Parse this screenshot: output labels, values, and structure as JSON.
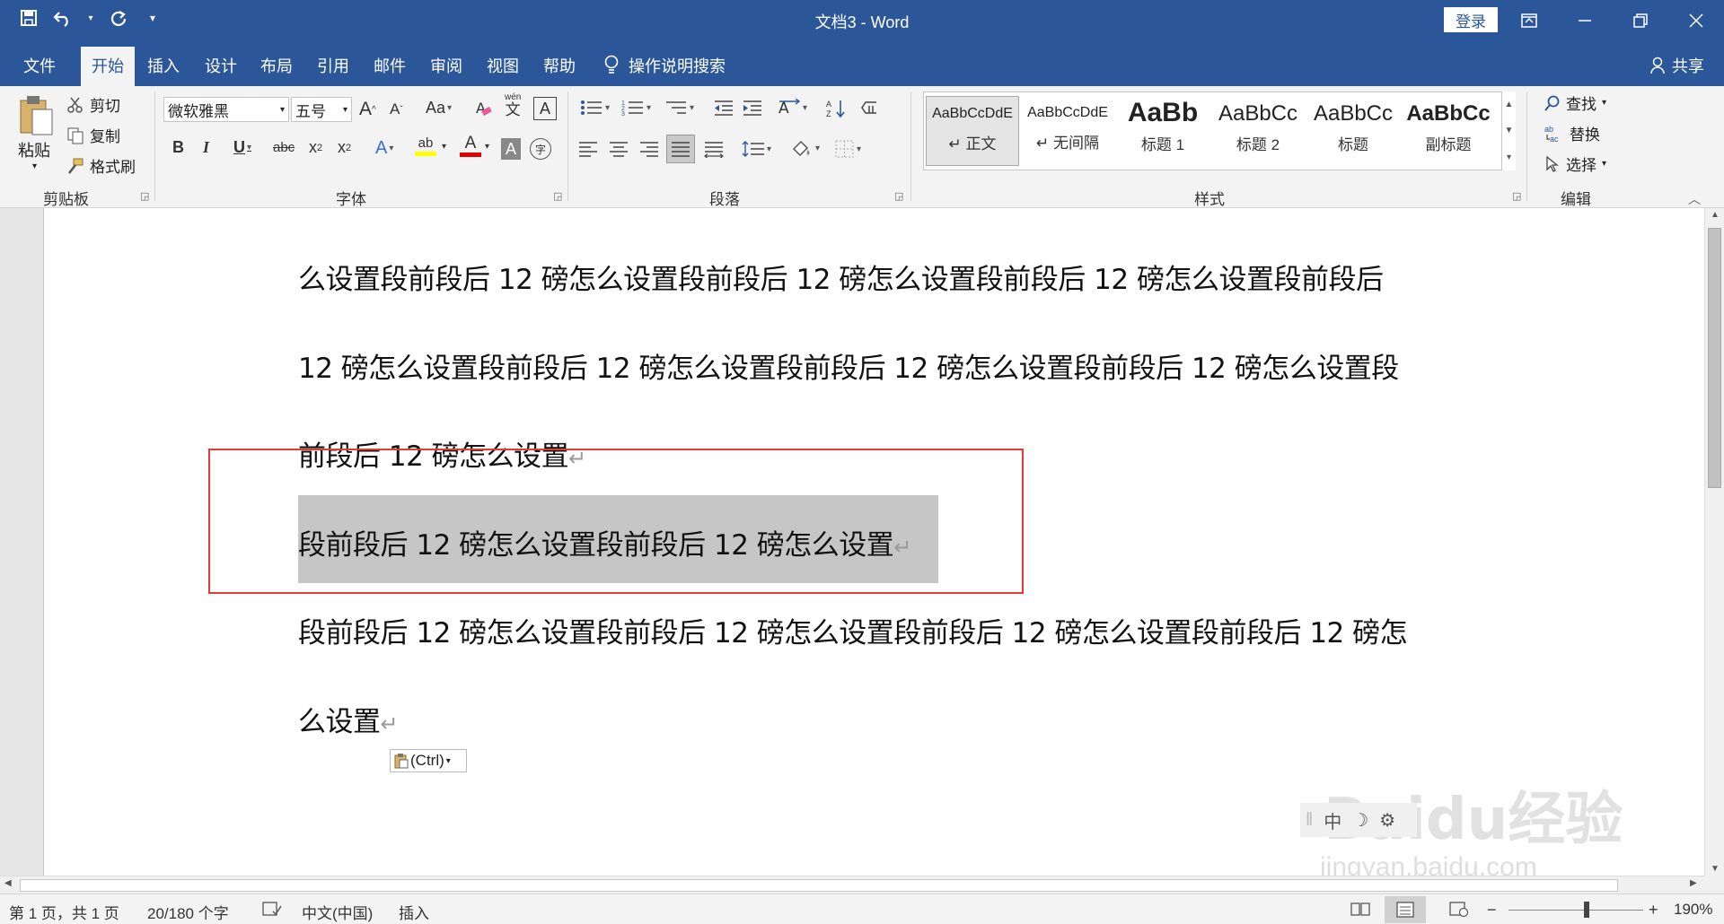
{
  "window": {
    "title": "文档3  -  Word",
    "login_label": "登录"
  },
  "tabs": [
    "文件",
    "开始",
    "插入",
    "设计",
    "布局",
    "引用",
    "邮件",
    "审阅",
    "视图",
    "帮助"
  ],
  "tell_me": "操作说明搜索",
  "share_label": "共享",
  "clipboard": {
    "paste": "粘贴",
    "cut": "剪切",
    "copy": "复制",
    "format_painter": "格式刷",
    "group_label": "剪贴板"
  },
  "font": {
    "name": "微软雅黑",
    "size": "五号",
    "group_label": "字体",
    "grow": "A",
    "shrink": "A",
    "case": "Aa",
    "bold": "B",
    "italic": "I",
    "underline": "U",
    "strike": "abc",
    "subscript": "x",
    "subscript_mark": "2",
    "superscript": "x",
    "superscript_mark": "2",
    "phonetic": "wén",
    "phonetic_char": "文",
    "border_char": "A",
    "text_effect": "A",
    "highlight": "ab",
    "font_color": "A",
    "char_shading": "A",
    "enclose": "字",
    "highlight_color": "#ffff00",
    "font_color_value": "#e00000"
  },
  "paragraph": {
    "group_label": "段落"
  },
  "styles": {
    "group_label": "样式",
    "items": [
      {
        "preview": "AaBbCcDdE",
        "name": "正文",
        "selected": true
      },
      {
        "preview": "AaBbCcDdE",
        "name": "无间隔",
        "selected": false
      },
      {
        "preview": "AaBb",
        "name": "标题 1",
        "selected": false
      },
      {
        "preview": "AaBbCc",
        "name": "标题 2",
        "selected": false
      },
      {
        "preview": "AaBbCc",
        "name": "标题",
        "selected": false
      },
      {
        "preview": "AaBbCc",
        "name": "副标题",
        "selected": false
      }
    ]
  },
  "editing": {
    "find": "查找",
    "replace": "替换",
    "select": "选择",
    "group_label": "编辑"
  },
  "document": {
    "paragraphs": [
      {
        "text": "么设置段前段后 12 磅怎么设置段前段后 12 磅怎么设置段前段后 12 磅怎么设置段前段后",
        "mark": "",
        "selected": false
      },
      {
        "text": "12 磅怎么设置段前段后 12 磅怎么设置段前段后 12 磅怎么设置段前段后 12 磅怎么设置段",
        "mark": "",
        "selected": false
      },
      {
        "text": "前段后 12 磅怎么设置",
        "mark": "↵",
        "selected": false
      },
      {
        "text": "段前段后 12 磅怎么设置段前段后 12 磅怎么设置",
        "mark": "↵",
        "selected": true
      },
      {
        "text": "段前段后 12 磅怎么设置段前段后 12 磅怎么设置段前段后 12 磅怎么设置段前段后 12 磅怎",
        "mark": "",
        "selected": false
      },
      {
        "text": "么设置",
        "mark": "↵",
        "selected": false
      }
    ],
    "paste_options": "(Ctrl)"
  },
  "ime": {
    "mode": "中",
    "moon": "☽",
    "gear": "⚙"
  },
  "watermark": {
    "text": "Baidu经验",
    "url": "jingyan.baidu.com"
  },
  "status": {
    "page": "第 1 页，共 1 页",
    "words": "20/180 个字",
    "language": "中文(中国)",
    "mode": "插入",
    "zoom": "190%",
    "zoom_minus": "−",
    "zoom_plus": "+"
  },
  "colors": {
    "accent": "#2b579a",
    "selection": "#c6c6c6",
    "annotation_box": "#e53935"
  }
}
